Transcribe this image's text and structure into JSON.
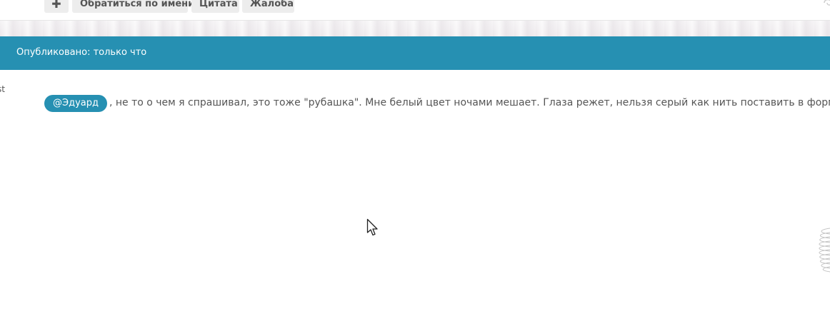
{
  "action_bar": {
    "plus_label": "✚",
    "mention_label": "Обратиться по имени",
    "quote_label": "Цитата",
    "report_label": "Жалоба"
  },
  "post": {
    "published": "Опубликовано: только что",
    "author_fragment": "st",
    "mention": "@Эдуард",
    "text": ", не то о чем я спрашивал, это тоже \"рубашка\". Мне белый цвет ночами мешает. Глаза режет, нельзя серый как нить поставить в форме сообщения"
  },
  "colors": {
    "accent": "#2690b2",
    "button_bg": "#ededed",
    "text": "#555555"
  },
  "icons": {
    "cursor": "mouse-pointer-icon",
    "spring": "spring-decoration-icon",
    "corner": "quote-decoration-icon"
  }
}
